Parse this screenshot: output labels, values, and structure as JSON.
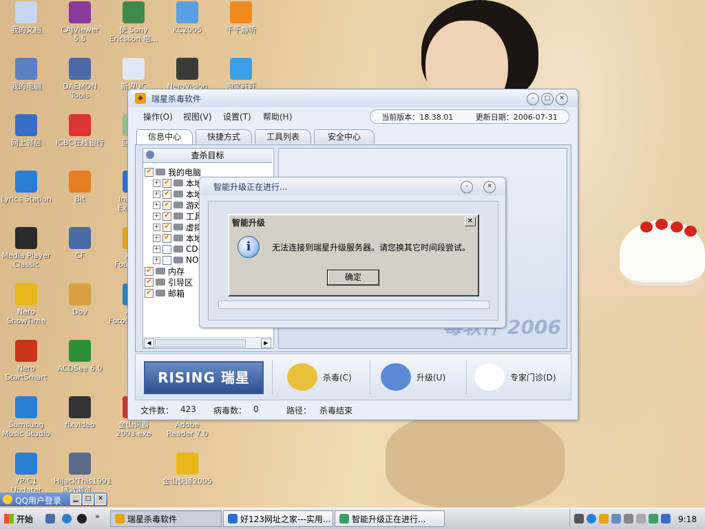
{
  "desktop": {
    "icons": [
      {
        "label": "我的文档",
        "color": "#c7d7ef"
      },
      {
        "label": "CAJViewer 5.5",
        "color": "#8a3a9b"
      },
      {
        "label": "使 Sony Ericsson 电...",
        "color": "#3d8a4a"
      },
      {
        "label": "KC2005",
        "color": "#5aa0e0"
      },
      {
        "label": "千千静听",
        "color": "#f08a1e"
      },
      {
        "label": "我的电脑",
        "color": "#5b7fc4"
      },
      {
        "label": "DAEMON Tools",
        "color": "#4a6aa8"
      },
      {
        "label": "新浪UC",
        "color": "#dfe8f4"
      },
      {
        "label": "NeroVision",
        "color": "#3a3a3a"
      },
      {
        "label": "淘宝旺旺",
        "color": "#3aa0e8"
      },
      {
        "label": "网上邻居",
        "color": "#3a6dc6"
      },
      {
        "label": "ICBC在线银行",
        "color": "#d33"
      },
      {
        "label": "回收站",
        "color": "#8fbf8f"
      },
      {
        "label": "Lyrics Station",
        "color": "#2a7fd4"
      },
      {
        "label": "Bit",
        "color": "#e67e22"
      },
      {
        "label": "Internet Explorer",
        "color": "#2a6fd1"
      },
      {
        "label": "Media Player Classic",
        "color": "#2b2b2b"
      },
      {
        "label": "CF",
        "color": "#4a6aa8"
      },
      {
        "label": "ACD FotoCan...",
        "color": "#e3a41c"
      },
      {
        "label": "Nero ShowTime",
        "color": "#e8b81c"
      },
      {
        "label": "Dov",
        "color": "#d8a040"
      },
      {
        "label": "ACD FotoSlate 3.0",
        "color": "#2a82c4"
      },
      {
        "label": "Nero StartSmart",
        "color": "#c8361a"
      },
      {
        "label": "ACDSee 6.0",
        "color": "#2b8f3a"
      },
      {
        "label": "Samsung Music Studio",
        "color": "#2a7fd4"
      },
      {
        "label": "fixvideo",
        "color": "#333333"
      },
      {
        "label": "金山词霸 2003.exe",
        "color": "#c33"
      },
      {
        "label": "Adobe Reader 7.0",
        "color": "#c8201a"
      },
      {
        "label": "YP-C1 Updater",
        "color": "#2a7fd4"
      },
      {
        "label": "HijackThis1991 拯救浏览...",
        "color": "#5a6a8a"
      },
      {
        "label": "金山快译2005",
        "color": "#e8b81c"
      }
    ]
  },
  "main_window": {
    "title": "瑞星杀毒软件",
    "menu": [
      "操作(O)",
      "视图(V)",
      "设置(T)",
      "帮助(H)"
    ],
    "version_label": "当前版本：18.38.01",
    "update_label": "更新日期：2006-07-31",
    "tabs": [
      "信息中心",
      "快捷方式",
      "工具列表",
      "安全中心"
    ],
    "scan_target_label": "查杀目标",
    "tree": [
      {
        "label": "我的电脑",
        "level": 0,
        "checked": true,
        "expand": false,
        "icon": "computer-icon"
      },
      {
        "label": "本地磁",
        "level": 1,
        "checked": true,
        "expand": true,
        "icon": "drive-icon"
      },
      {
        "label": "本地磁",
        "level": 1,
        "checked": true,
        "expand": true,
        "icon": "drive-icon"
      },
      {
        "label": "游戏(",
        "level": 1,
        "checked": true,
        "expand": true,
        "icon": "drive-icon"
      },
      {
        "label": "工具软",
        "level": 1,
        "checked": true,
        "expand": true,
        "icon": "drive-icon"
      },
      {
        "label": "虚拟(",
        "level": 1,
        "checked": true,
        "expand": true,
        "icon": "drive-icon"
      },
      {
        "label": "本地磁",
        "level": 1,
        "checked": true,
        "expand": true,
        "icon": "drive-icon"
      },
      {
        "label": "CD-RW",
        "level": 1,
        "checked": false,
        "expand": true,
        "icon": "cd-icon"
      },
      {
        "label": "NORTC",
        "level": 1,
        "checked": false,
        "expand": true,
        "icon": "bulb-icon"
      },
      {
        "label": "内存",
        "level": 0,
        "checked": true,
        "expand": false,
        "icon": "memory-icon"
      },
      {
        "label": "引导区",
        "level": 0,
        "checked": true,
        "expand": false,
        "icon": "boot-icon"
      },
      {
        "label": "邮箱",
        "level": 0,
        "checked": true,
        "expand": false,
        "icon": "mail-icon"
      }
    ],
    "watermark": "毒软件 2006",
    "logo_text": "RISING 瑞星",
    "actions": [
      {
        "label": "杀毒(C)",
        "icon": "magnifier-icon",
        "color": "#e8c23a"
      },
      {
        "label": "升级(U)",
        "icon": "globe-upgrade-icon",
        "color": "#5a8ad4"
      },
      {
        "label": "专家门诊(D)",
        "icon": "hand-icon",
        "color": "#ffffff"
      }
    ],
    "status": {
      "files_label": "文件数：",
      "files_value": "423",
      "virus_label": "病毒数：",
      "virus_value": "0",
      "path_label": "路径：",
      "path_value": "杀毒结束"
    }
  },
  "progress_window": {
    "title": "智能升级正在进行..."
  },
  "message_box": {
    "title": "智能升级",
    "text": "无法连接到瑞星升级服务器。请您换其它时间段尝试。",
    "ok_label": "确定"
  },
  "qq_bar": {
    "title": "QQ用户登录"
  },
  "taskbar": {
    "start_label": "开始",
    "tasks": [
      {
        "label": "瑞星杀毒软件",
        "active": true,
        "color": "#e9a20e"
      },
      {
        "label": "好123网址之家---实用...",
        "active": false,
        "color": "#2a6fd1"
      },
      {
        "label": "智能升级正在进行...",
        "active": false,
        "color": "#3aa06a"
      }
    ],
    "clock": "9:18"
  }
}
